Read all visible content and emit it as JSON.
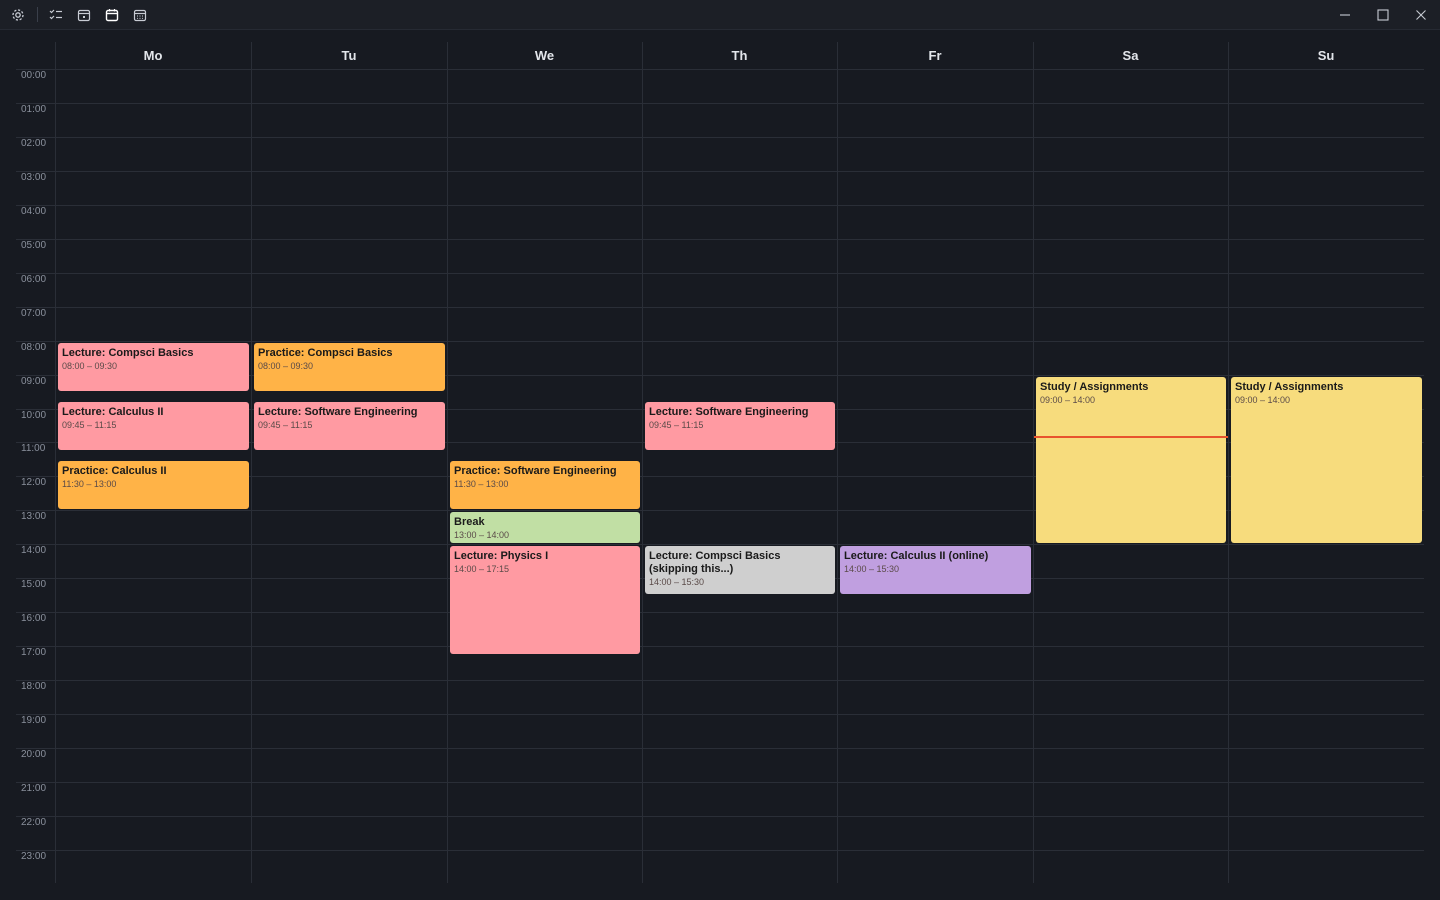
{
  "toolbar": {
    "icons": [
      "gear-icon",
      "checklist-icon",
      "calendar-day-icon",
      "calendar-week-icon",
      "calendar-month-icon"
    ],
    "window_controls": [
      "minimize-icon",
      "maximize-icon",
      "close-icon"
    ]
  },
  "days": [
    "Mo",
    "Tu",
    "We",
    "Th",
    "Fr",
    "Sa",
    "Su"
  ],
  "hours": [
    "00:00",
    "01:00",
    "02:00",
    "03:00",
    "04:00",
    "05:00",
    "06:00",
    "07:00",
    "08:00",
    "09:00",
    "10:00",
    "11:00",
    "12:00",
    "13:00",
    "14:00",
    "15:00",
    "16:00",
    "17:00",
    "18:00",
    "19:00",
    "20:00",
    "21:00",
    "22:00",
    "23:00"
  ],
  "colors": {
    "lecture": "#ff9aa2",
    "practice": "#ffb347",
    "break": "#c1dfa4",
    "skipped": "#cfcfcf",
    "online": "#c09fe0",
    "study": "#f7dc7d",
    "now_line": "#e8532d"
  },
  "events": [
    {
      "day": 0,
      "title": "Lecture: Compsci Basics",
      "time": "08:00 – 09:30",
      "start": 8.0,
      "end": 9.5,
      "kind": "lecture"
    },
    {
      "day": 0,
      "title": "Lecture: Calculus II",
      "time": "09:45 – 11:15",
      "start": 9.75,
      "end": 11.25,
      "kind": "lecture"
    },
    {
      "day": 0,
      "title": "Practice: Calculus II",
      "time": "11:30 – 13:00",
      "start": 11.5,
      "end": 13.0,
      "kind": "practice"
    },
    {
      "day": 1,
      "title": "Practice: Compsci Basics",
      "time": "08:00 – 09:30",
      "start": 8.0,
      "end": 9.5,
      "kind": "practice"
    },
    {
      "day": 1,
      "title": "Lecture: Software Engineering",
      "time": "09:45 – 11:15",
      "start": 9.75,
      "end": 11.25,
      "kind": "lecture"
    },
    {
      "day": 2,
      "title": "Practice: Software Engineering",
      "time": "11:30 – 13:00",
      "start": 11.5,
      "end": 13.0,
      "kind": "practice"
    },
    {
      "day": 2,
      "title": "Break",
      "time": "13:00 – 14:00",
      "start": 13.0,
      "end": 14.0,
      "kind": "break"
    },
    {
      "day": 2,
      "title": "Lecture: Physics I",
      "time": "14:00 – 17:15",
      "start": 14.0,
      "end": 17.25,
      "kind": "lecture"
    },
    {
      "day": 3,
      "title": "Lecture: Software Engineering",
      "time": "09:45 – 11:15",
      "start": 9.75,
      "end": 11.25,
      "kind": "lecture"
    },
    {
      "day": 3,
      "title": "Lecture: Compsci Basics (skipping this...)",
      "time": "14:00 – 15:30",
      "start": 14.0,
      "end": 15.5,
      "kind": "skipped"
    },
    {
      "day": 4,
      "title": "Lecture: Calculus II (online)",
      "time": "14:00 – 15:30",
      "start": 14.0,
      "end": 15.5,
      "kind": "online"
    },
    {
      "day": 5,
      "title": "Study / Assignments",
      "time": "09:00 – 14:00",
      "start": 9.0,
      "end": 14.0,
      "kind": "study"
    },
    {
      "day": 6,
      "title": "Study / Assignments",
      "time": "09:00 – 14:00",
      "start": 9.0,
      "end": 14.0,
      "kind": "study"
    }
  ],
  "now": {
    "day": 5,
    "hour": 10.8
  }
}
